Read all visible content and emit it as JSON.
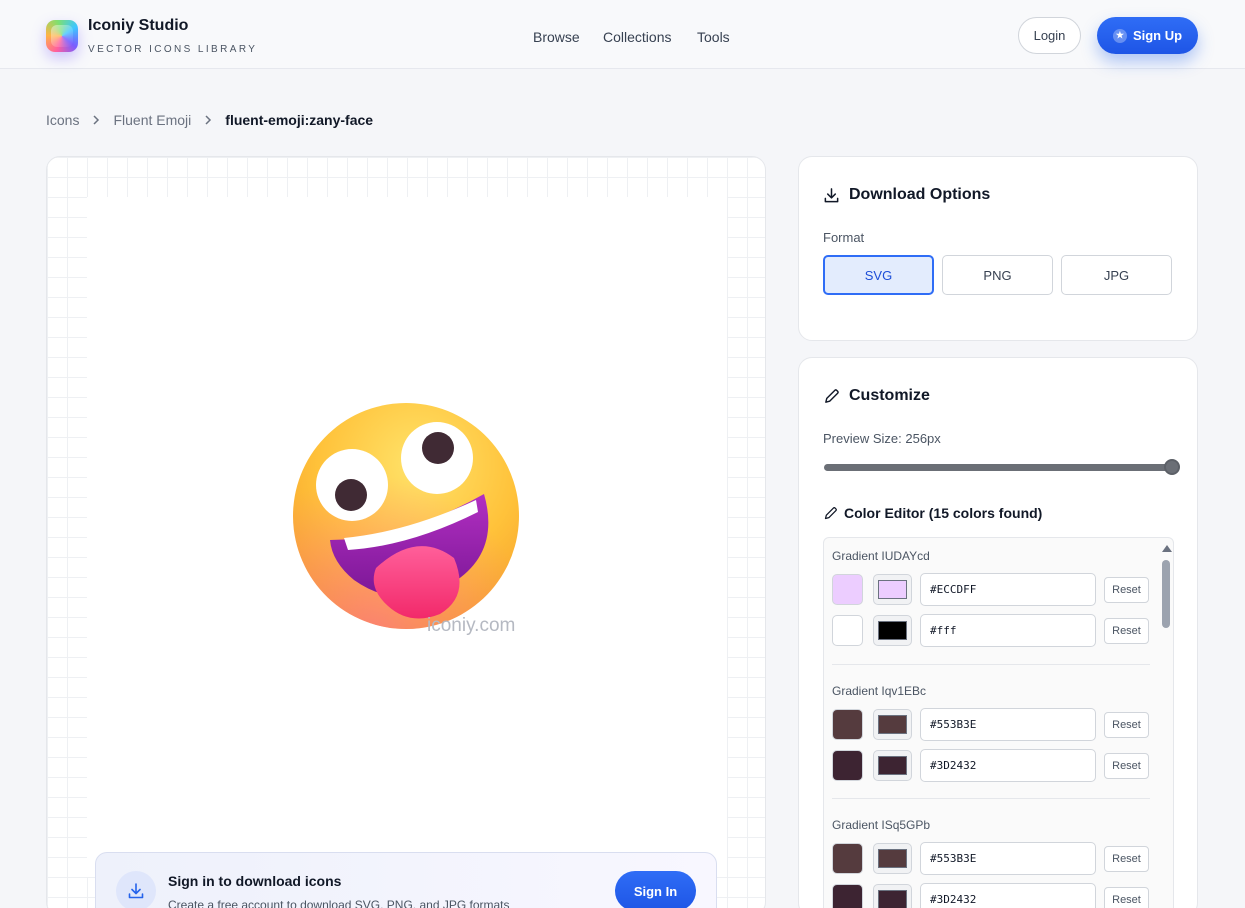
{
  "header": {
    "brand_name": "Iconiy Studio",
    "brand_tagline": "VECTOR ICONS LIBRARY",
    "nav": [
      "Browse",
      "Collections",
      "Tools"
    ],
    "login_label": "Login",
    "signup_label": "Sign Up"
  },
  "breadcrumb": {
    "items": [
      "Icons",
      "Fluent Emoji"
    ],
    "current": "fluent-emoji:zany-face"
  },
  "preview": {
    "watermark": "iconiy.com",
    "signin_title": "Sign in to download icons",
    "signin_subtitle": "Create a free account to download SVG, PNG, and JPG formats",
    "signin_button": "Sign In"
  },
  "download": {
    "title": "Download Options",
    "format_label": "Format",
    "formats": [
      "SVG",
      "PNG",
      "JPG"
    ],
    "selected_format": "SVG"
  },
  "customize": {
    "title": "Customize",
    "preview_size_label": "Preview Size: 256px",
    "preview_size_fraction": 1.0,
    "color_editor_title": "Color Editor (15 colors found)",
    "reset_label": "Reset",
    "gradients": [
      {
        "name": "Gradient IUDAYcd",
        "colors": [
          {
            "swatch": "#ECCDFF",
            "picker": "#ECCDFF",
            "hex": "#ECCDFF"
          },
          {
            "swatch": "#FFFFFF",
            "picker": "#000000",
            "hex": "#fff"
          }
        ]
      },
      {
        "name": "Gradient Iqv1EBc",
        "colors": [
          {
            "swatch": "#553B3E",
            "picker": "#553B3E",
            "hex": "#553B3E"
          },
          {
            "swatch": "#3D2432",
            "picker": "#3D2432",
            "hex": "#3D2432"
          }
        ]
      },
      {
        "name": "Gradient ISq5GPb",
        "colors": [
          {
            "swatch": "#553B3E",
            "picker": "#553B3E",
            "hex": "#553B3E"
          },
          {
            "swatch": "#3D2432",
            "picker": "#3D2432",
            "hex": "#3D2432"
          }
        ]
      }
    ]
  },
  "colors": {
    "accent": "#2563EB",
    "accent_light": "#E3ECFD"
  }
}
